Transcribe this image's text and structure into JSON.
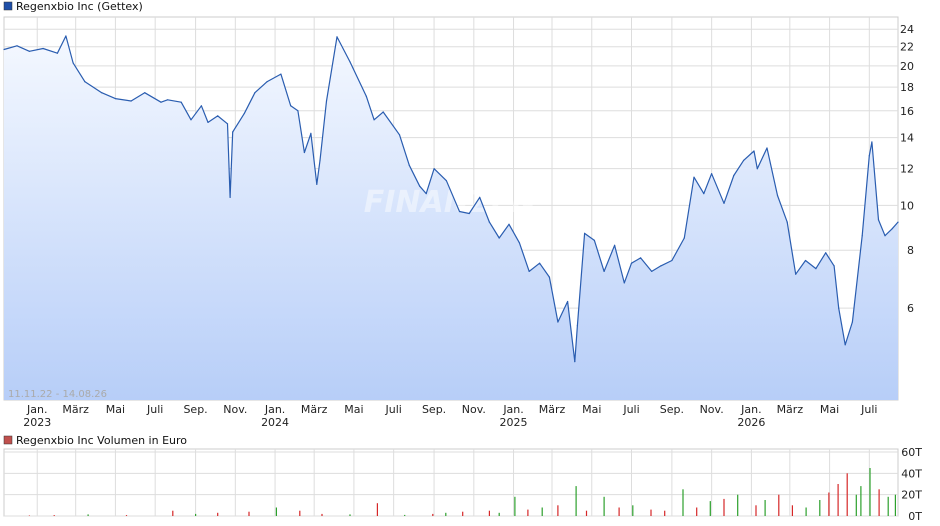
{
  "chart_data": [
    {
      "type": "area",
      "series": [
        {
          "name": "Regenxbio Inc (Gettex)",
          "x": [
            "2022-11-11",
            "2022-12-01",
            "2022-12-20",
            "2023-01-10",
            "2023-02-01",
            "2023-02-14",
            "2023-02-25",
            "2023-03-15",
            "2023-04-10",
            "2023-05-01",
            "2023-05-25",
            "2023-06-15",
            "2023-07-10",
            "2023-07-20",
            "2023-08-10",
            "2023-08-25",
            "2023-09-10",
            "2023-09-20",
            "2023-10-05",
            "2023-10-20",
            "2023-10-24",
            "2023-10-28",
            "2023-11-15",
            "2023-12-01",
            "2023-12-20",
            "2024-01-10",
            "2024-01-25",
            "2024-02-05",
            "2024-02-15",
            "2024-02-25",
            "2024-03-05",
            "2024-03-10",
            "2024-03-20",
            "2024-04-05",
            "2024-04-25",
            "2024-05-20",
            "2024-06-01",
            "2024-06-15",
            "2024-07-10",
            "2024-07-25",
            "2024-08-10",
            "2024-08-20",
            "2024-09-01",
            "2024-09-20",
            "2024-10-10",
            "2024-10-25",
            "2024-11-10",
            "2024-11-25",
            "2024-12-10",
            "2024-12-25",
            "2025-01-10",
            "2025-01-25",
            "2025-02-10",
            "2025-02-25",
            "2025-03-10",
            "2025-03-25",
            "2025-04-05",
            "2025-04-09",
            "2025-04-20",
            "2025-05-05",
            "2025-05-20",
            "2025-06-05",
            "2025-06-20",
            "2025-07-01",
            "2025-07-15",
            "2025-08-01",
            "2025-08-15",
            "2025-09-01",
            "2025-09-20",
            "2025-10-05",
            "2025-10-20",
            "2025-11-01",
            "2025-11-20",
            "2025-12-05",
            "2025-12-20",
            "2026-01-05",
            "2026-01-10",
            "2026-01-25",
            "2026-02-10",
            "2026-02-25",
            "2026-03-10",
            "2026-03-25",
            "2026-04-10",
            "2026-04-25",
            "2026-05-08",
            "2026-05-15",
            "2026-05-25",
            "2026-06-05",
            "2026-06-20",
            "2026-07-01",
            "2026-07-05",
            "2026-07-15",
            "2026-07-25",
            "2026-08-05",
            "2026-08-14"
          ],
          "values": [
            21.7,
            22.1,
            21.5,
            21.8,
            21.3,
            23.2,
            20.3,
            18.5,
            17.5,
            17.0,
            16.8,
            17.5,
            16.7,
            16.9,
            16.7,
            15.3,
            16.4,
            15.1,
            15.6,
            15.0,
            10.4,
            14.4,
            15.8,
            17.5,
            18.5,
            19.2,
            16.4,
            16.0,
            13.0,
            14.3,
            11.1,
            12.5,
            16.8,
            23.1,
            20.4,
            17.2,
            15.3,
            15.9,
            14.2,
            12.2,
            11.0,
            10.6,
            12.0,
            11.3,
            9.7,
            9.6,
            10.4,
            9.2,
            8.5,
            9.1,
            8.3,
            7.2,
            7.5,
            7.0,
            5.6,
            6.2,
            4.6,
            5.5,
            8.7,
            8.4,
            7.2,
            8.2,
            6.8,
            7.5,
            7.7,
            7.2,
            7.4,
            7.6,
            8.5,
            11.5,
            10.6,
            11.7,
            10.1,
            11.6,
            12.5,
            13.1,
            12.0,
            13.3,
            10.5,
            9.2,
            7.1,
            7.6,
            7.3,
            7.9,
            7.4,
            6.0,
            5.0,
            5.6,
            8.6,
            12.8,
            13.7,
            9.3,
            8.6,
            8.9,
            9.2
          ]
        }
      ],
      "x_tick_labels": [
        {
          "date": "2023-01-01",
          "label": "Jan.",
          "year": "2023"
        },
        {
          "date": "2023-03-01",
          "label": "März",
          "year": ""
        },
        {
          "date": "2023-05-01",
          "label": "Mai",
          "year": ""
        },
        {
          "date": "2023-07-01",
          "label": "Juli",
          "year": ""
        },
        {
          "date": "2023-09-01",
          "label": "Sep.",
          "year": ""
        },
        {
          "date": "2023-11-01",
          "label": "Nov.",
          "year": ""
        },
        {
          "date": "2024-01-01",
          "label": "Jan.",
          "year": "2024"
        },
        {
          "date": "2024-03-01",
          "label": "März",
          "year": ""
        },
        {
          "date": "2024-05-01",
          "label": "Mai",
          "year": ""
        },
        {
          "date": "2024-07-01",
          "label": "Juli",
          "year": ""
        },
        {
          "date": "2024-09-01",
          "label": "Sep.",
          "year": ""
        },
        {
          "date": "2024-11-01",
          "label": "Nov.",
          "year": ""
        },
        {
          "date": "2025-01-01",
          "label": "Jan.",
          "year": "2025"
        },
        {
          "date": "2025-03-01",
          "label": "März",
          "year": ""
        },
        {
          "date": "2025-05-01",
          "label": "Mai",
          "year": ""
        },
        {
          "date": "2025-07-01",
          "label": "Juli",
          "year": ""
        },
        {
          "date": "2025-09-01",
          "label": "Sep.",
          "year": ""
        },
        {
          "date": "2025-11-01",
          "label": "Nov.",
          "year": ""
        },
        {
          "date": "2026-01-01",
          "label": "Jan.",
          "year": "2026"
        },
        {
          "date": "2026-03-01",
          "label": "März",
          "year": ""
        },
        {
          "date": "2026-05-01",
          "label": "Mai",
          "year": ""
        },
        {
          "date": "2026-07-01",
          "label": "Juli",
          "year": ""
        }
      ],
      "y_ticks": [
        6,
        8,
        10,
        12,
        14,
        16,
        18,
        20,
        22,
        24
      ],
      "y_scale": "log",
      "xlim": [
        "2022-11-11",
        "2026-08-14"
      ],
      "ylim": [
        3.8,
        25.5
      ],
      "date_range_label": "11.11.22 - 14.08.26",
      "legend": "top-left",
      "grid": true,
      "line_color": "#2a5db0",
      "fill_top_color": "#f4f8ff",
      "fill_bottom_color": "#b7cef8",
      "legend_marker_color": "#1f4fa8",
      "watermark": "FINANZEN"
    },
    {
      "type": "bar",
      "series": [
        {
          "name": "Regenxbio Inc Volumen in Euro",
          "x": [
            "2022-12-20",
            "2023-01-27",
            "2023-03-20",
            "2023-05-18",
            "2023-07-28",
            "2023-09-01",
            "2023-10-05",
            "2023-11-22",
            "2024-01-03",
            "2024-02-08",
            "2024-03-13",
            "2024-04-25",
            "2024-06-06",
            "2024-07-18",
            "2024-08-30",
            "2024-09-19",
            "2024-10-15",
            "2024-11-25",
            "2024-12-10",
            "2025-01-03",
            "2025-01-23",
            "2025-02-14",
            "2025-03-10",
            "2025-04-07",
            "2025-04-23",
            "2025-05-20",
            "2025-06-12",
            "2025-07-03",
            "2025-07-31",
            "2025-08-21",
            "2025-09-18",
            "2025-10-09",
            "2025-10-30",
            "2025-11-20",
            "2025-12-11",
            "2026-01-08",
            "2026-01-22",
            "2026-02-12",
            "2026-03-05",
            "2026-03-26",
            "2026-04-16",
            "2026-04-30",
            "2026-05-14",
            "2026-05-28",
            "2026-06-11",
            "2026-06-18",
            "2026-07-02",
            "2026-07-16",
            "2026-07-30",
            "2026-08-10"
          ],
          "values": [
            0.5,
            0.8,
            1.5,
            0.8,
            5.0,
            2.0,
            3.0,
            4.0,
            8.0,
            5.0,
            2.0,
            1.5,
            12.0,
            1.0,
            2.0,
            3.0,
            4.0,
            5.0,
            3.0,
            18.0,
            6.0,
            8.0,
            10.0,
            28.0,
            5.0,
            18.0,
            8.0,
            10.0,
            6.0,
            5.0,
            25.0,
            8.0,
            14.0,
            16.0,
            20.0,
            10.0,
            15.0,
            20.0,
            10.0,
            8.0,
            15.0,
            22.0,
            30.0,
            40.0,
            20.0,
            28.0,
            45.0,
            25.0,
            18.0,
            20.0
          ],
          "colors": [
            "red",
            "red",
            "green",
            "red",
            "red",
            "green",
            "red",
            "red",
            "green",
            "red",
            "red",
            "green",
            "red",
            "green",
            "red",
            "green",
            "red",
            "red",
            "green",
            "green",
            "red",
            "green",
            "red",
            "green",
            "red",
            "green",
            "red",
            "green",
            "red",
            "red",
            "green",
            "red",
            "green",
            "red",
            "green",
            "red",
            "green",
            "red",
            "red",
            "green",
            "green",
            "red",
            "red",
            "red",
            "green",
            "green",
            "green",
            "red",
            "green",
            "green"
          ]
        }
      ],
      "y_ticks": [
        "0T",
        "20T",
        "40T",
        "60T"
      ],
      "ylim": [
        0,
        60
      ],
      "up_color": "#2ca02c",
      "down_color": "#d62728",
      "legend_marker_color": "#c0504d",
      "legend": "top-left",
      "grid": true
    }
  ]
}
